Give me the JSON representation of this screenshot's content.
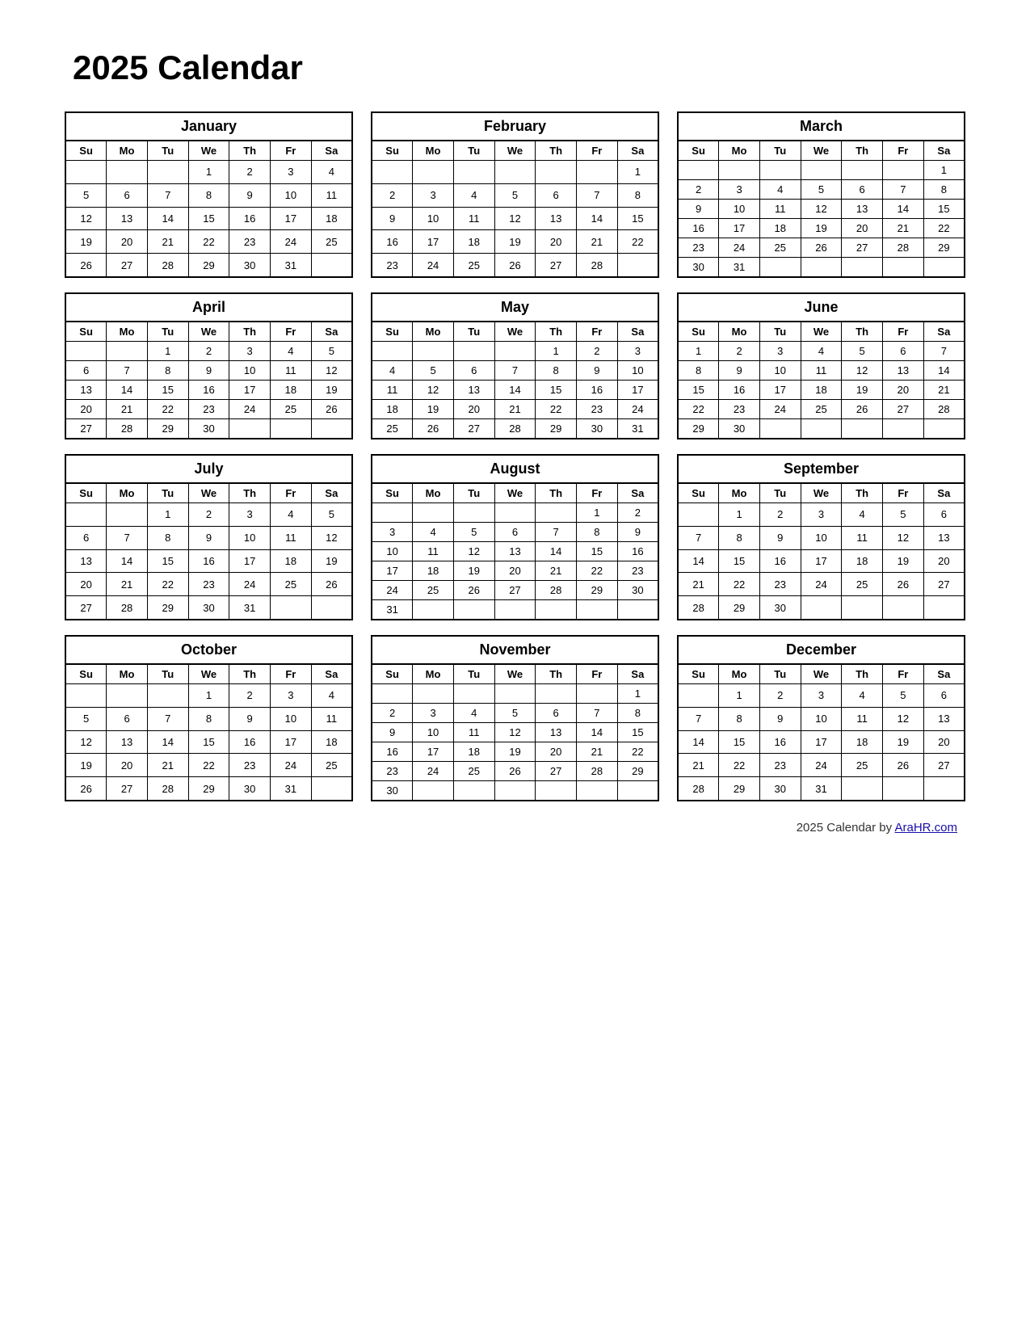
{
  "title": "2025 Calendar",
  "footer": {
    "text": "2025  Calendar by ",
    "link_text": "AraHR.com",
    "link_url": "#"
  },
  "days_header": [
    "Su",
    "Mo",
    "Tu",
    "We",
    "Th",
    "Fr",
    "Sa"
  ],
  "months": [
    {
      "name": "January",
      "weeks": [
        [
          "",
          "",
          "",
          "1",
          "2",
          "3",
          "4"
        ],
        [
          "5",
          "6",
          "7",
          "8",
          "9",
          "10",
          "11"
        ],
        [
          "12",
          "13",
          "14",
          "15",
          "16",
          "17",
          "18"
        ],
        [
          "19",
          "20",
          "21",
          "22",
          "23",
          "24",
          "25"
        ],
        [
          "26",
          "27",
          "28",
          "29",
          "30",
          "31",
          ""
        ]
      ]
    },
    {
      "name": "February",
      "weeks": [
        [
          "",
          "",
          "",
          "",
          "",
          "",
          "1"
        ],
        [
          "2",
          "3",
          "4",
          "5",
          "6",
          "7",
          "8"
        ],
        [
          "9",
          "10",
          "11",
          "12",
          "13",
          "14",
          "15"
        ],
        [
          "16",
          "17",
          "18",
          "19",
          "20",
          "21",
          "22"
        ],
        [
          "23",
          "24",
          "25",
          "26",
          "27",
          "28",
          ""
        ]
      ]
    },
    {
      "name": "March",
      "weeks": [
        [
          "",
          "",
          "",
          "",
          "",
          "",
          "1"
        ],
        [
          "2",
          "3",
          "4",
          "5",
          "6",
          "7",
          "8"
        ],
        [
          "9",
          "10",
          "11",
          "12",
          "13",
          "14",
          "15"
        ],
        [
          "16",
          "17",
          "18",
          "19",
          "20",
          "21",
          "22"
        ],
        [
          "23",
          "24",
          "25",
          "26",
          "27",
          "28",
          "29"
        ],
        [
          "30",
          "31",
          "",
          "",
          "",
          "",
          ""
        ]
      ]
    },
    {
      "name": "April",
      "weeks": [
        [
          "",
          "",
          "1",
          "2",
          "3",
          "4",
          "5"
        ],
        [
          "6",
          "7",
          "8",
          "9",
          "10",
          "11",
          "12"
        ],
        [
          "13",
          "14",
          "15",
          "16",
          "17",
          "18",
          "19"
        ],
        [
          "20",
          "21",
          "22",
          "23",
          "24",
          "25",
          "26"
        ],
        [
          "27",
          "28",
          "29",
          "30",
          "",
          "",
          ""
        ]
      ]
    },
    {
      "name": "May",
      "weeks": [
        [
          "",
          "",
          "",
          "",
          "1",
          "2",
          "3"
        ],
        [
          "4",
          "5",
          "6",
          "7",
          "8",
          "9",
          "10"
        ],
        [
          "11",
          "12",
          "13",
          "14",
          "15",
          "16",
          "17"
        ],
        [
          "18",
          "19",
          "20",
          "21",
          "22",
          "23",
          "24"
        ],
        [
          "25",
          "26",
          "27",
          "28",
          "29",
          "30",
          "31"
        ]
      ]
    },
    {
      "name": "June",
      "weeks": [
        [
          "1",
          "2",
          "3",
          "4",
          "5",
          "6",
          "7"
        ],
        [
          "8",
          "9",
          "10",
          "11",
          "12",
          "13",
          "14"
        ],
        [
          "15",
          "16",
          "17",
          "18",
          "19",
          "20",
          "21"
        ],
        [
          "22",
          "23",
          "24",
          "25",
          "26",
          "27",
          "28"
        ],
        [
          "29",
          "30",
          "",
          "",
          "",
          "",
          ""
        ]
      ]
    },
    {
      "name": "July",
      "weeks": [
        [
          "",
          "",
          "1",
          "2",
          "3",
          "4",
          "5"
        ],
        [
          "6",
          "7",
          "8",
          "9",
          "10",
          "11",
          "12"
        ],
        [
          "13",
          "14",
          "15",
          "16",
          "17",
          "18",
          "19"
        ],
        [
          "20",
          "21",
          "22",
          "23",
          "24",
          "25",
          "26"
        ],
        [
          "27",
          "28",
          "29",
          "30",
          "31",
          "",
          ""
        ]
      ]
    },
    {
      "name": "August",
      "weeks": [
        [
          "",
          "",
          "",
          "",
          "",
          "1",
          "2"
        ],
        [
          "3",
          "4",
          "5",
          "6",
          "7",
          "8",
          "9"
        ],
        [
          "10",
          "11",
          "12",
          "13",
          "14",
          "15",
          "16"
        ],
        [
          "17",
          "18",
          "19",
          "20",
          "21",
          "22",
          "23"
        ],
        [
          "24",
          "25",
          "26",
          "27",
          "28",
          "29",
          "30"
        ],
        [
          "31",
          "",
          "",
          "",
          "",
          "",
          ""
        ]
      ]
    },
    {
      "name": "September",
      "weeks": [
        [
          "",
          "1",
          "2",
          "3",
          "4",
          "5",
          "6"
        ],
        [
          "7",
          "8",
          "9",
          "10",
          "11",
          "12",
          "13"
        ],
        [
          "14",
          "15",
          "16",
          "17",
          "18",
          "19",
          "20"
        ],
        [
          "21",
          "22",
          "23",
          "24",
          "25",
          "26",
          "27"
        ],
        [
          "28",
          "29",
          "30",
          "",
          "",
          "",
          ""
        ]
      ]
    },
    {
      "name": "October",
      "weeks": [
        [
          "",
          "",
          "",
          "1",
          "2",
          "3",
          "4"
        ],
        [
          "5",
          "6",
          "7",
          "8",
          "9",
          "10",
          "11"
        ],
        [
          "12",
          "13",
          "14",
          "15",
          "16",
          "17",
          "18"
        ],
        [
          "19",
          "20",
          "21",
          "22",
          "23",
          "24",
          "25"
        ],
        [
          "26",
          "27",
          "28",
          "29",
          "30",
          "31",
          ""
        ]
      ]
    },
    {
      "name": "November",
      "weeks": [
        [
          "",
          "",
          "",
          "",
          "",
          "",
          "1"
        ],
        [
          "2",
          "3",
          "4",
          "5",
          "6",
          "7",
          "8"
        ],
        [
          "9",
          "10",
          "11",
          "12",
          "13",
          "14",
          "15"
        ],
        [
          "16",
          "17",
          "18",
          "19",
          "20",
          "21",
          "22"
        ],
        [
          "23",
          "24",
          "25",
          "26",
          "27",
          "28",
          "29"
        ],
        [
          "30",
          "",
          "",
          "",
          "",
          "",
          ""
        ]
      ]
    },
    {
      "name": "December",
      "weeks": [
        [
          "",
          "1",
          "2",
          "3",
          "4",
          "5",
          "6"
        ],
        [
          "7",
          "8",
          "9",
          "10",
          "11",
          "12",
          "13"
        ],
        [
          "14",
          "15",
          "16",
          "17",
          "18",
          "19",
          "20"
        ],
        [
          "21",
          "22",
          "23",
          "24",
          "25",
          "26",
          "27"
        ],
        [
          "28",
          "29",
          "30",
          "31",
          "",
          "",
          ""
        ]
      ]
    }
  ]
}
